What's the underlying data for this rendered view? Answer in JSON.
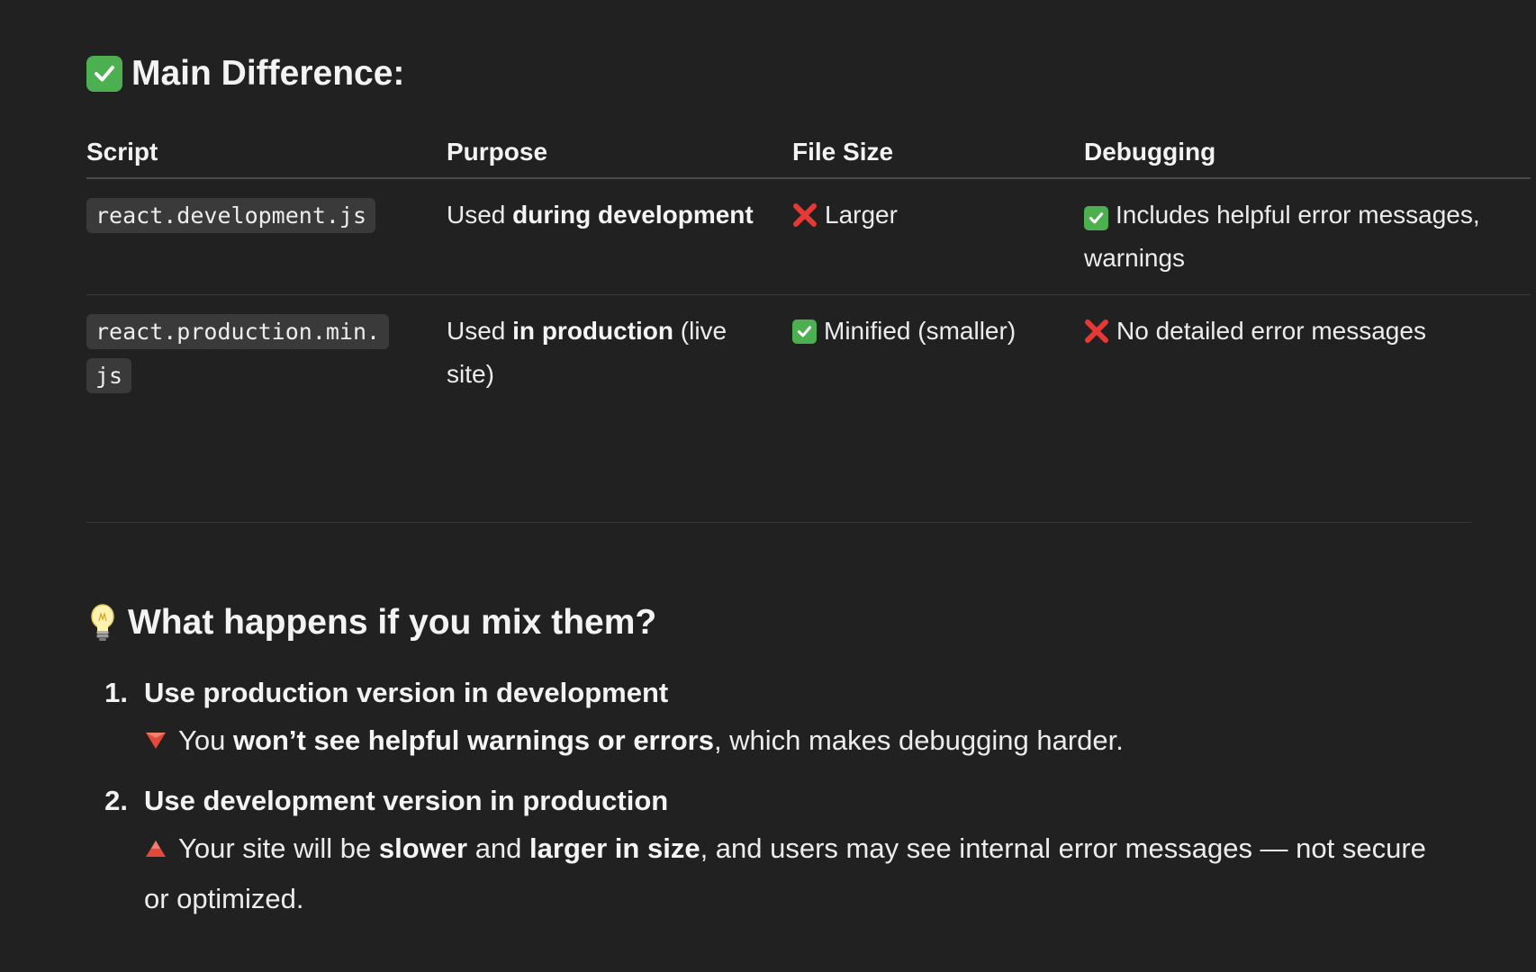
{
  "section1": {
    "title": "Main Difference:",
    "icon": "check-mark-button-icon"
  },
  "table": {
    "headers": [
      "Script",
      "Purpose",
      "File Size",
      "Debugging"
    ],
    "rows": [
      {
        "script": "react.development.js",
        "purpose_pre": "Used ",
        "purpose_bold": "during development",
        "purpose_post": "",
        "file_size_icon": "cross-mark-icon",
        "file_size": "Larger",
        "debugging_icon": "check-mark-button-icon",
        "debugging": "Includes helpful error messages, warnings"
      },
      {
        "script": "react.production.min.js",
        "purpose_pre": "Used ",
        "purpose_bold": "in production",
        "purpose_post": " (live site)",
        "file_size_icon": "check-mark-button-icon",
        "file_size": "Minified (smaller)",
        "debugging_icon": "cross-mark-icon",
        "debugging": "No detailed error messages"
      }
    ]
  },
  "section2": {
    "title": "What happens if you mix them?",
    "icon": "light-bulb-icon",
    "items": [
      {
        "number": "1.",
        "title": "Use production version in development",
        "icon": "red-triangle-down-icon",
        "text_pre": "You ",
        "text_bold1": "won’t see helpful warnings or errors",
        "text_mid": ", which makes debugging harder.",
        "text_bold2": "",
        "text_post": ""
      },
      {
        "number": "2.",
        "title": "Use development version in production",
        "icon": "red-triangle-up-icon",
        "text_pre": "Your site will be ",
        "text_bold1": "slower",
        "text_mid": " and ",
        "text_bold2": "larger in size",
        "text_post": ", and users may see internal error messages — not secure or optimized."
      }
    ]
  },
  "colors": {
    "background": "#212121",
    "text": "#ececec",
    "check_green": "#4caf50",
    "cross_red": "#e53935",
    "code_bg": "#3a3a3a"
  }
}
